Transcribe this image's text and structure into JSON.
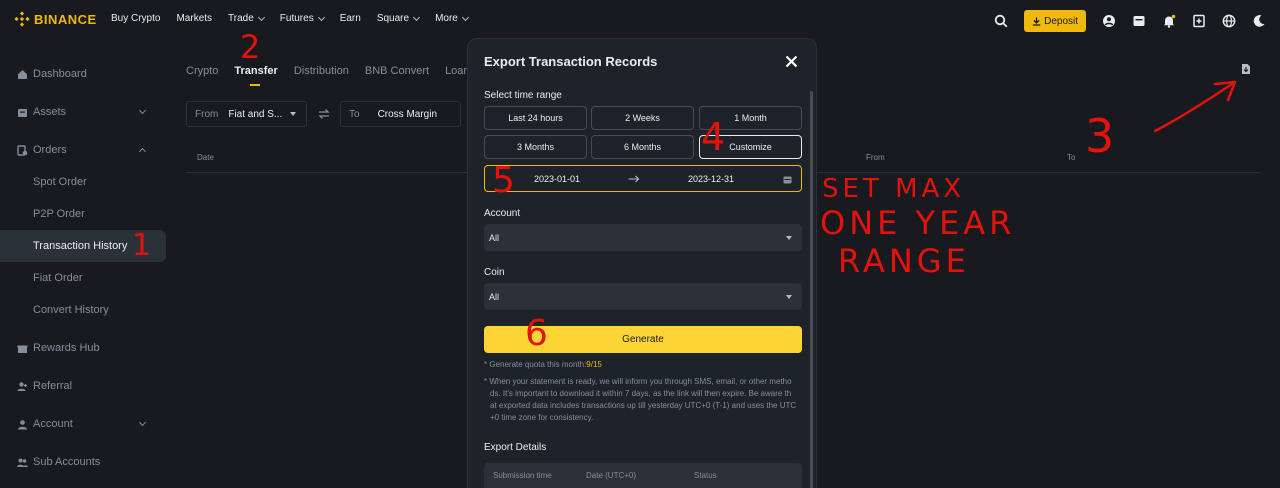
{
  "nav": {
    "brand": "BINANCE",
    "links": [
      "Buy Crypto",
      "Markets",
      "Trade",
      "Futures",
      "Earn",
      "Square",
      "More"
    ],
    "deposit_label": "Deposit",
    "accent": "#f0b90b"
  },
  "sidebar": {
    "items": [
      {
        "label": "Dashboard",
        "icon": "home-icon"
      },
      {
        "label": "Assets",
        "icon": "wallet-icon"
      },
      {
        "label": "Orders",
        "icon": "orders-icon"
      },
      {
        "label": "Spot Order"
      },
      {
        "label": "P2P Order"
      },
      {
        "label": "Transaction History"
      },
      {
        "label": "Fiat Order"
      },
      {
        "label": "Convert History"
      },
      {
        "label": "Rewards Hub",
        "icon": "gift-icon"
      },
      {
        "label": "Referral",
        "icon": "user-plus-icon"
      },
      {
        "label": "Account",
        "icon": "user-icon"
      },
      {
        "label": "Sub Accounts",
        "icon": "users-icon"
      }
    ]
  },
  "main": {
    "tabs": [
      "Crypto",
      "Transfer",
      "Distribution",
      "BNB Convert",
      "Loan"
    ],
    "from_label": "From",
    "from_value": "Fiat and S...",
    "to_label": "To",
    "to_value": "Cross Margin",
    "columns": {
      "date": "Date",
      "from": "From",
      "to": "To"
    }
  },
  "modal": {
    "title": "Export Transaction Records",
    "time_range_label": "Select time range",
    "ranges": [
      "Last 24 hours",
      "2 Weeks",
      "1 Month",
      "3 Months",
      "6 Months",
      "Customize"
    ],
    "selected_range": "Customize",
    "start_date": "2023-01-01",
    "end_date": "2023-12-31",
    "account_label": "Account",
    "account_value": "All",
    "coin_label": "Coin",
    "coin_value": "All",
    "generate_label": "Generate",
    "quota_text": "* Generate quota this month:",
    "quota_value": "9/15",
    "note_lines": [
      "* When your statement is ready, we will inform you through SMS, email, or other metho",
      "ds. It's important to download it within 7 days, as the link will then expire. Be aware th",
      "at exported data includes transactions up till yesterday UTC+0 (T-1) and uses the UTC",
      "+0 time zone for consistency."
    ],
    "details_label": "Export Details",
    "details_columns": [
      "Submission time",
      "Date (UTC+0)",
      "Status"
    ]
  },
  "annotations": {
    "steps": [
      "1",
      "2",
      "3",
      "4",
      "5",
      "6"
    ],
    "note_lines": [
      "SET MAX",
      "ONE YEAR",
      "RANGE"
    ],
    "color": "#e3120b"
  }
}
